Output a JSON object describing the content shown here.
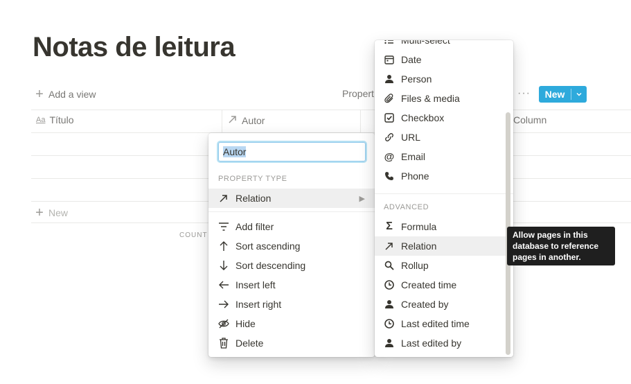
{
  "page": {
    "title": "Notas de leitura"
  },
  "toolbar": {
    "add_view": "Add a view",
    "properties_partial": "Propert",
    "more": "···",
    "new_label": "New"
  },
  "table": {
    "columns": [
      "Título",
      "Autor",
      "Column"
    ],
    "new_row": "New",
    "count_partial": "COUNT"
  },
  "property_menu": {
    "name_value": "Autor",
    "section_property_type": "PROPERTY TYPE",
    "current_type": "Relation",
    "actions": [
      {
        "label": "Add filter",
        "icon": "filter-icon"
      },
      {
        "label": "Sort ascending",
        "icon": "arrow-up-icon"
      },
      {
        "label": "Sort descending",
        "icon": "arrow-down-icon"
      },
      {
        "label": "Insert left",
        "icon": "arrow-left-icon"
      },
      {
        "label": "Insert right",
        "icon": "arrow-right-icon"
      },
      {
        "label": "Hide",
        "icon": "eye-off-icon"
      },
      {
        "label": "Delete",
        "icon": "trash-icon"
      }
    ]
  },
  "type_menu": {
    "basic": [
      {
        "label": "Multi-select",
        "icon": "list-icon"
      },
      {
        "label": "Date",
        "icon": "calendar-icon"
      },
      {
        "label": "Person",
        "icon": "person-icon"
      },
      {
        "label": "Files & media",
        "icon": "paperclip-icon"
      },
      {
        "label": "Checkbox",
        "icon": "checkbox-icon"
      },
      {
        "label": "URL",
        "icon": "link-icon"
      },
      {
        "label": "Email",
        "icon": "at-icon"
      },
      {
        "label": "Phone",
        "icon": "phone-icon"
      }
    ],
    "section_advanced": "ADVANCED",
    "advanced": [
      {
        "label": "Formula",
        "icon": "sigma-icon"
      },
      {
        "label": "Relation",
        "icon": "relation-arrow-icon"
      },
      {
        "label": "Rollup",
        "icon": "magnifier-icon"
      },
      {
        "label": "Created time",
        "icon": "clock-icon"
      },
      {
        "label": "Created by",
        "icon": "person-icon"
      },
      {
        "label": "Last edited time",
        "icon": "clock-icon"
      },
      {
        "label": "Last edited by",
        "icon": "person-icon"
      }
    ],
    "highlighted": "Relation"
  },
  "tooltip": {
    "lines": [
      "Allow pages in this",
      "database to reference",
      "pages in another."
    ]
  },
  "colors": {
    "accent": "#2eaadc",
    "text": "#37352f",
    "muted": "#787774"
  }
}
